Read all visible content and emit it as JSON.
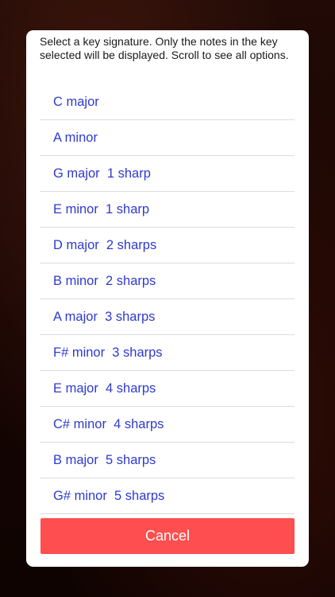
{
  "dialog": {
    "prompt": "Select a key signature. Only the notes in the key selected will be displayed.  Scroll to see all options.",
    "options": [
      "C major",
      "A minor",
      "G major  1 sharp",
      "E minor  1 sharp",
      "D major  2 sharps",
      "B minor  2 sharps",
      "A major  3 sharps",
      "F# minor  3 sharps",
      "E major  4 sharps",
      "C# minor  4 sharps",
      "B major  5 sharps",
      "G# minor  5 sharps"
    ],
    "cancel_label": "Cancel"
  },
  "colors": {
    "option_text": "#2e3ad0",
    "cancel_bg": "#ff4e4f",
    "sheet_bg": "#ffffff"
  }
}
